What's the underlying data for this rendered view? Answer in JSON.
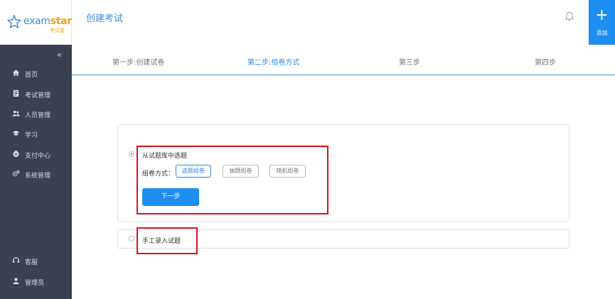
{
  "brand": {
    "name_main": "exam",
    "name_accent": "star",
    "name_sub": "考试星"
  },
  "sidebar": {
    "collapse_glyph": "«",
    "items": [
      {
        "label": "首页",
        "icon": "home-icon"
      },
      {
        "label": "考试管理",
        "icon": "file-icon"
      },
      {
        "label": "人员管理",
        "icon": "users-icon"
      },
      {
        "label": "学习",
        "icon": "graduation-cap-icon"
      },
      {
        "label": "支付中心",
        "icon": "payment-icon"
      },
      {
        "label": "系统管理",
        "icon": "gears-icon"
      }
    ],
    "bottom_items": [
      {
        "label": "客服",
        "icon": "headset-icon"
      },
      {
        "label": "管理员",
        "icon": "user-icon"
      }
    ]
  },
  "header": {
    "title": "创建考试",
    "add_label": "添加",
    "add_glyph": "+"
  },
  "steps": [
    {
      "label": "第一步:创建试卷",
      "active": false
    },
    {
      "label": "第二步:组卷方式",
      "active": true
    },
    {
      "label": "第三步",
      "active": false
    },
    {
      "label": "第四步",
      "active": false
    }
  ],
  "form": {
    "option_bank": "从试题库中选题",
    "mode_label": "组卷方式：",
    "modes": [
      "选题组卷",
      "抽题组卷",
      "随机组卷"
    ],
    "active_mode": "选题组卷",
    "next_label": "下一步",
    "option_manual": "手工录入试题"
  },
  "colors": {
    "accent": "#1f8ef1",
    "sidebar_bg": "#3a4150",
    "highlight": "#d7141e"
  }
}
